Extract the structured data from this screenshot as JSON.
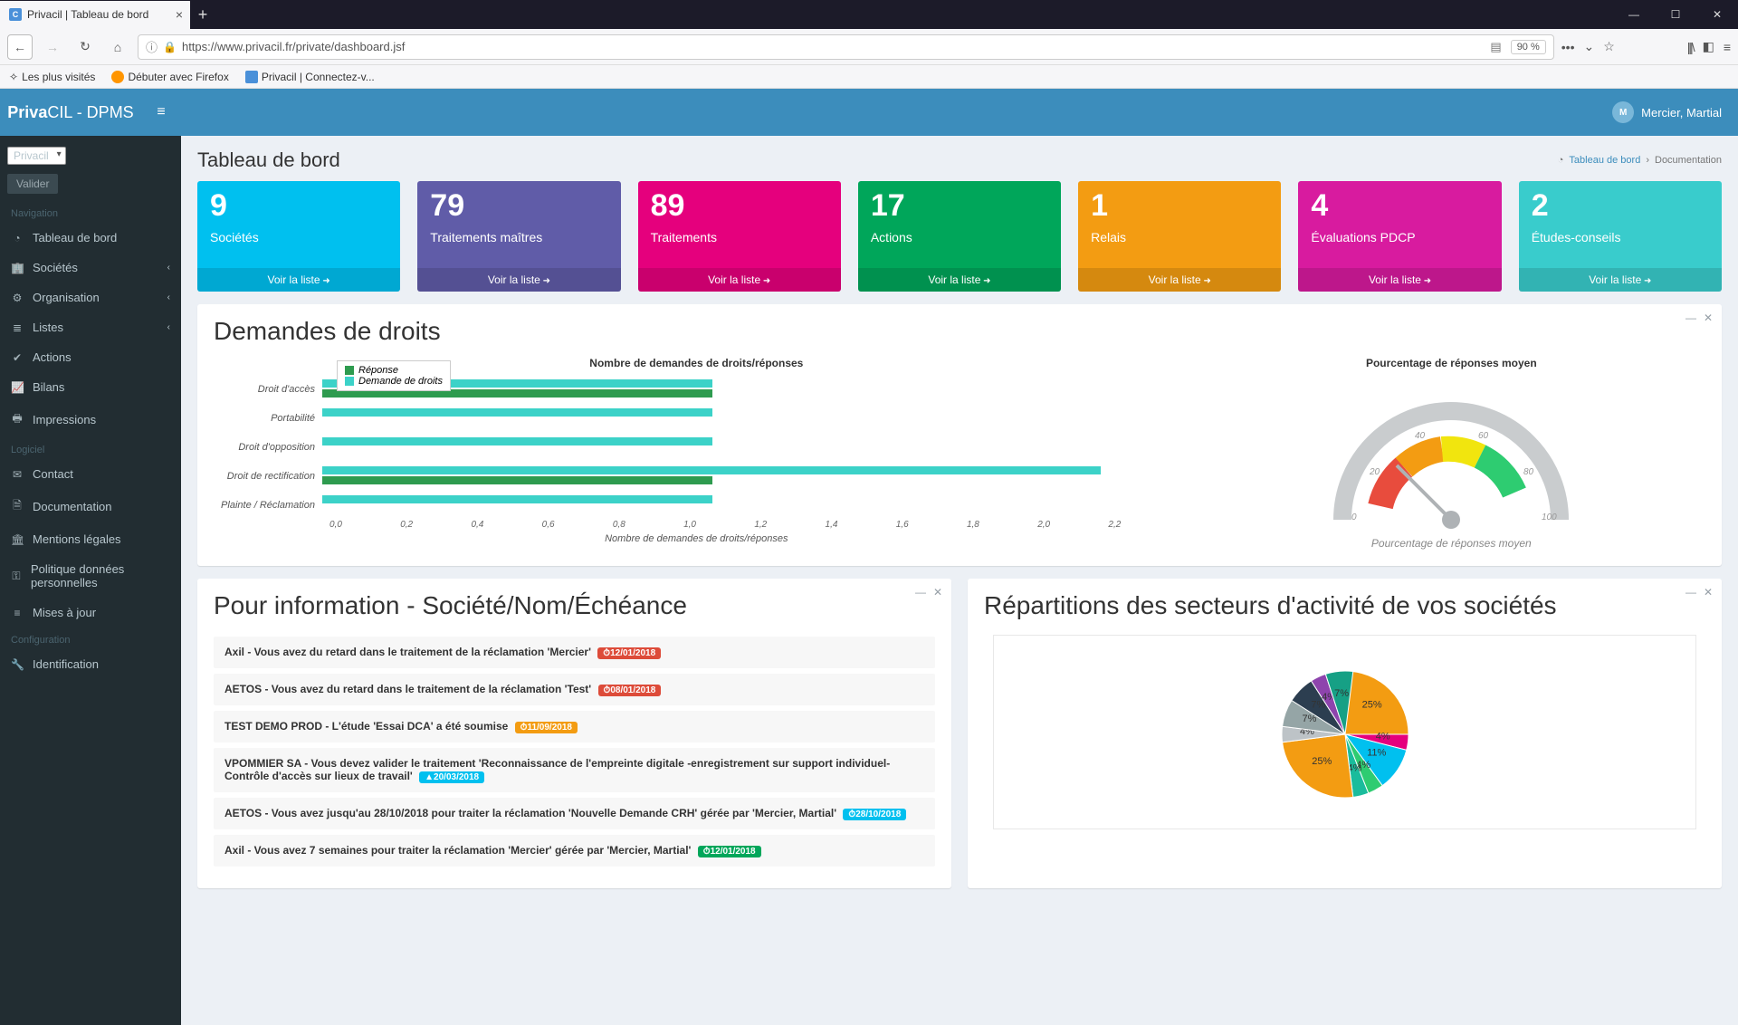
{
  "browser": {
    "tab_title": "Privacil | Tableau de bord",
    "url": "https://www.privacil.fr/private/dashboard.jsf",
    "zoom": "90 %",
    "bookmarks": [
      "Les plus visités",
      "Débuter avec Firefox",
      "Privacil | Connectez-v..."
    ]
  },
  "app": {
    "brand_a": "Priva",
    "brand_b": "CIL",
    "brand_c": " - DPMS",
    "user": "Mercier, Martial"
  },
  "sidebar": {
    "select": "Privacil",
    "valider": "Valider",
    "sections": {
      "nav": "Navigation",
      "log": "Logiciel",
      "conf": "Configuration"
    },
    "items": {
      "dashboard": "Tableau de bord",
      "societes": "Sociétés",
      "organisation": "Organisation",
      "listes": "Listes",
      "actions": "Actions",
      "bilans": "Bilans",
      "impressions": "Impressions",
      "contact": "Contact",
      "documentation": "Documentation",
      "mentions": "Mentions légales",
      "politique": "Politique données personnelles",
      "mises": "Mises à jour",
      "ident": "Identification"
    }
  },
  "page": {
    "title": "Tableau de bord",
    "breadcrumb": [
      "Tableau de bord",
      "Documentation"
    ]
  },
  "cards": [
    {
      "num": "9",
      "label": "Sociétés",
      "footer": "Voir la liste"
    },
    {
      "num": "79",
      "label": "Traitements maîtres",
      "footer": "Voir la liste"
    },
    {
      "num": "89",
      "label": "Traitements",
      "footer": "Voir la liste"
    },
    {
      "num": "17",
      "label": "Actions",
      "footer": "Voir la liste"
    },
    {
      "num": "1",
      "label": "Relais",
      "footer": "Voir la liste"
    },
    {
      "num": "4",
      "label": "Évaluations PDCP",
      "footer": "Voir la liste"
    },
    {
      "num": "2",
      "label": "Études-conseils",
      "footer": "Voir la liste"
    }
  ],
  "rights_panel": {
    "title": "Demandes de droits",
    "bar_title": "Nombre de demandes de droits/réponses",
    "gauge_title": "Pourcentage de réponses moyen",
    "gauge_caption": "Pourcentage de réponses moyen",
    "legend": {
      "a": "Réponse",
      "b": "Demande de droits"
    },
    "x_label": "Nombre de demandes de droits/réponses"
  },
  "info_panel": {
    "title": "Pour information - Société/Nom/Échéance",
    "items": [
      {
        "text": "Axil - Vous avez du retard dans le traitement de la réclamation 'Mercier'",
        "date": "12/01/2018",
        "cls": "bd-red",
        "icon": "⏱"
      },
      {
        "text": "AETOS - Vous avez du retard dans le traitement de la réclamation 'Test'",
        "date": "08/01/2018",
        "cls": "bd-red",
        "icon": "⏱"
      },
      {
        "text": "TEST DEMO PROD - L'étude 'Essai DCA' a été soumise",
        "date": "11/09/2018",
        "cls": "bd-orange",
        "icon": "⏱"
      },
      {
        "text": "VPOMMIER SA - Vous devez valider le traitement 'Reconnaissance de l'empreinte digitale -enregistrement sur support individuel-Contrôle d'accès sur lieux de travail'",
        "date": "20/03/2018",
        "cls": "bd-teal",
        "icon": "▲"
      },
      {
        "text": "AETOS - Vous avez jusqu'au 28/10/2018 pour traiter la réclamation 'Nouvelle Demande CRH' gérée par 'Mercier, Martial'",
        "date": "28/10/2018",
        "cls": "bd-teal",
        "icon": "⏱"
      },
      {
        "text": "Axil - Vous avez 7 semaines pour traiter la réclamation 'Mercier' gérée par 'Mercier, Martial'",
        "date": "12/01/2018",
        "cls": "bd-green",
        "icon": "⏱"
      }
    ]
  },
  "sectors_panel": {
    "title": "Répartitions des secteurs d'activité de vos sociétés"
  },
  "chart_data": [
    {
      "type": "bar",
      "orientation": "horizontal",
      "title": "Nombre de demandes de droits/réponses",
      "xlabel": "Nombre de demandes de droits/réponses",
      "xlim": [
        0,
        2.2
      ],
      "xticks": [
        0.0,
        0.2,
        0.4,
        0.6,
        0.8,
        1.0,
        1.2,
        1.4,
        1.6,
        1.8,
        2.0,
        2.2
      ],
      "categories": [
        "Droit d'accès",
        "Portabilité",
        "Droit d'opposition",
        "Droit de rectification",
        "Plainte / Réclamation"
      ],
      "series": [
        {
          "name": "Réponse",
          "color": "#3cd2c8",
          "values": [
            1.0,
            1.0,
            1.0,
            2.0,
            1.0
          ]
        },
        {
          "name": "Demande de droits",
          "color": "#2e9b4f",
          "values": [
            1.0,
            0.0,
            0.0,
            1.0,
            0.0
          ]
        }
      ]
    },
    {
      "type": "gauge",
      "title": "Pourcentage de réponses moyen",
      "ticks": [
        0,
        20,
        40,
        60,
        80,
        100
      ],
      "value": 20,
      "zones": [
        {
          "from": 0,
          "to": 20,
          "color": "#e84c3d"
        },
        {
          "from": 20,
          "to": 40,
          "color": "#f39c12"
        },
        {
          "from": 40,
          "to": 60,
          "color": "#f1e50e"
        },
        {
          "from": 60,
          "to": 80,
          "color": "#2ecc71"
        }
      ]
    },
    {
      "type": "pie",
      "title": "Répartitions des secteurs d'activité de vos sociétés",
      "slices": [
        {
          "label": "25%",
          "value": 25,
          "color": "#f39c12"
        },
        {
          "label": "4%",
          "value": 4,
          "color": "#e5007d"
        },
        {
          "label": "11%",
          "value": 11,
          "color": "#00c0ef"
        },
        {
          "label": "4%",
          "value": 4,
          "color": "#2ecc71"
        },
        {
          "label": "4%",
          "value": 4,
          "color": "#1abc9c"
        },
        {
          "label": "25%",
          "value": 25,
          "color": "#f39c12"
        },
        {
          "label": "4%",
          "value": 4,
          "color": "#bdc3c7"
        },
        {
          "label": "7%",
          "value": 7,
          "color": "#95a5a6"
        },
        {
          "label": "7%",
          "value": 7,
          "color": "#2c3e50"
        },
        {
          "label": "4%",
          "value": 4,
          "color": "#8e44ad"
        },
        {
          "label": "7%",
          "value": 7,
          "color": "#16a085"
        }
      ]
    }
  ]
}
